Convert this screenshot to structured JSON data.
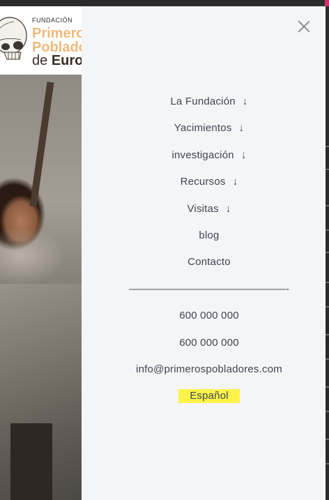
{
  "logo": {
    "small": "FUNDACIÓN",
    "line1": "Primeros",
    "line2": "Pobladores",
    "line3_light": "de ",
    "line3_bold": "Europa"
  },
  "menu": {
    "items": [
      {
        "label": "La Fundación",
        "arrow": "↓"
      },
      {
        "label": "Yacimientos",
        "arrow": "↓"
      },
      {
        "label": "investigación",
        "arrow": "↓"
      },
      {
        "label": "Recursos",
        "arrow": "↓"
      },
      {
        "label": "Visitas",
        "arrow": "↓"
      },
      {
        "label": "blog"
      },
      {
        "label": "Contacto"
      }
    ],
    "separator": "———————————————-",
    "phone1": "600 000 000",
    "phone2": "600 000 000",
    "email": "info@primerospobladores.com",
    "language": "Español"
  },
  "colors": {
    "panel_bg": "#f4f5f7",
    "text": "#3f4550",
    "logo_orange": "#f0b87a",
    "highlight": "#fbf34a"
  },
  "icons": {
    "close": "close-icon",
    "submenu": "arrow-down-icon"
  }
}
